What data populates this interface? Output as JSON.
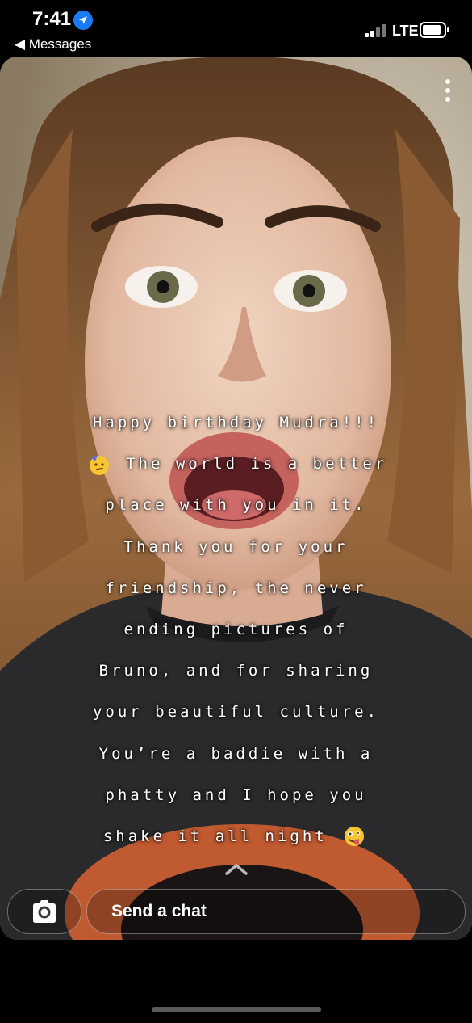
{
  "status_bar": {
    "time": "7:41",
    "back_label": "◀ Messages",
    "network": "LTE",
    "location_icon": "location-arrow-icon",
    "signal_icon": "signal-bars-icon",
    "battery_icon": "battery-icon"
  },
  "snap": {
    "caption_lines": [
      "Happy birthday Mudra!!!",
      " The world is a better",
      "place with you in it.",
      "Thank you for your",
      "friendship, the never",
      "ending pictures of",
      "Bruno, and for sharing",
      "your beautiful culture.",
      "You’re a baddie with a",
      "phatty and I hope you",
      "shake it all night "
    ],
    "emojis": [
      "partying-face-emoji",
      "zany-face-emoji"
    ],
    "menu_icon": "more-vertical-icon"
  },
  "bottom_bar": {
    "chat_placeholder": "Send a chat",
    "camera_icon": "camera-icon",
    "expand_icon": "chevron-up-icon"
  },
  "colors": {
    "background": "#000000",
    "location_blue": "#1a7cf5"
  }
}
